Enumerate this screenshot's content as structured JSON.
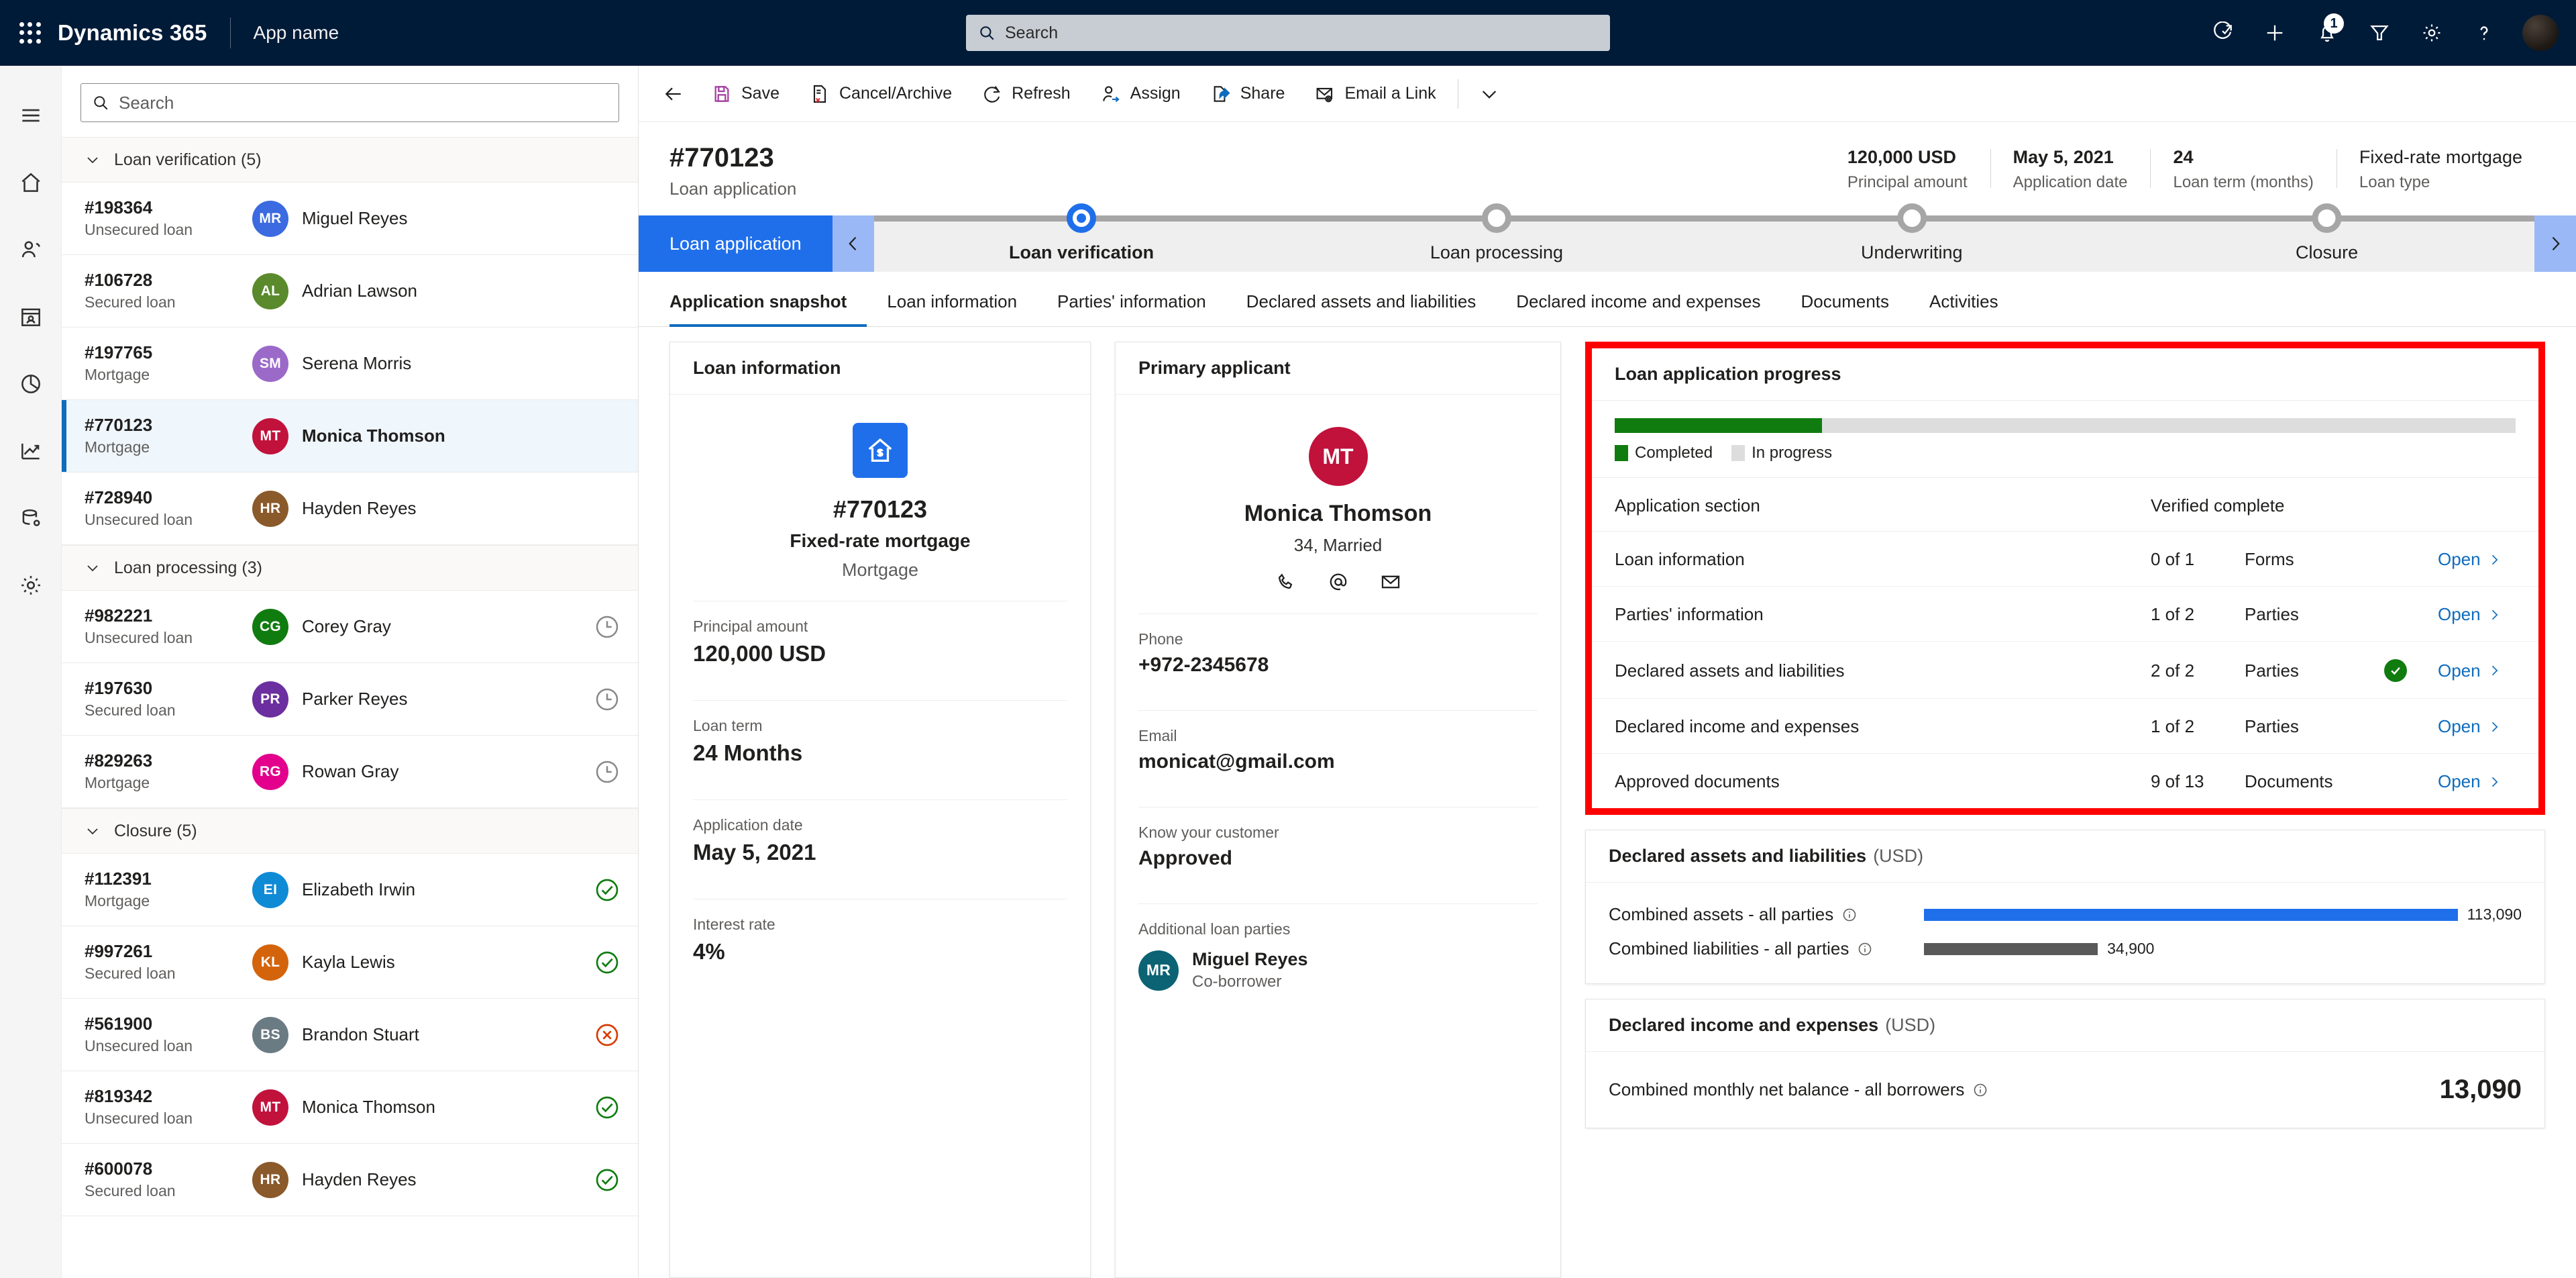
{
  "topnav": {
    "brand": "Dynamics 365",
    "app_name": "App name",
    "search_placeholder": "Search",
    "notification_count": "1",
    "icons": [
      "waffle-icon",
      "check-arrow-icon",
      "plus-icon",
      "bell-icon",
      "filter-icon",
      "gear-icon",
      "help-icon",
      "user-avatar"
    ]
  },
  "rail": {
    "items": [
      {
        "name": "hamburger-menu-icon"
      },
      {
        "name": "home-icon"
      },
      {
        "name": "recent-contacts-icon"
      },
      {
        "name": "pinned-records-icon"
      },
      {
        "name": "dashboard-icon"
      },
      {
        "name": "analytics-icon"
      },
      {
        "name": "data-icon"
      },
      {
        "name": "settings-icon"
      }
    ]
  },
  "list": {
    "search_placeholder": "Search",
    "groups": [
      {
        "label": "Loan verification (5)",
        "rows": [
          {
            "id": "#198364",
            "type": "Unsecured loan",
            "initials": "MR",
            "name": "Miguel Reyes",
            "color": "#3b6ae1",
            "status": "",
            "selected": false
          },
          {
            "id": "#106728",
            "type": "Secured loan",
            "initials": "AL",
            "name": "Adrian Lawson",
            "color": "#5a8a2b",
            "status": "",
            "selected": false
          },
          {
            "id": "#197765",
            "type": "Mortgage",
            "initials": "SM",
            "name": "Serena Morris",
            "color": "#9b6ac9",
            "status": "",
            "selected": false
          },
          {
            "id": "#770123",
            "type": "Mortgage",
            "initials": "MT",
            "name": "Monica Thomson",
            "color": "#c1123c",
            "status": "",
            "selected": true
          },
          {
            "id": "#728940",
            "type": "Unsecured loan",
            "initials": "HR",
            "name": "Hayden Reyes",
            "color": "#8a5a2b",
            "status": "",
            "selected": false
          }
        ]
      },
      {
        "label": "Loan processing (3)",
        "rows": [
          {
            "id": "#982221",
            "type": "Unsecured loan",
            "initials": "CG",
            "name": "Corey Gray",
            "color": "#107c10",
            "status": "pending",
            "selected": false
          },
          {
            "id": "#197630",
            "type": "Secured loan",
            "initials": "PR",
            "name": "Parker Reyes",
            "color": "#6b2fa0",
            "status": "pending",
            "selected": false
          },
          {
            "id": "#829263",
            "type": "Mortgage",
            "initials": "RG",
            "name": "Rowan Gray",
            "color": "#e3008c",
            "status": "pending",
            "selected": false
          }
        ]
      },
      {
        "label": "Closure (5)",
        "rows": [
          {
            "id": "#112391",
            "type": "Mortgage",
            "initials": "EI",
            "name": "Elizabeth Irwin",
            "color": "#0f8bd6",
            "status": "approved",
            "selected": false
          },
          {
            "id": "#997261",
            "type": "Secured loan",
            "initials": "KL",
            "name": "Kayla Lewis",
            "color": "#d4640c",
            "status": "approved",
            "selected": false
          },
          {
            "id": "#561900",
            "type": "Unsecured loan",
            "initials": "BS",
            "name": "Brandon Stuart",
            "color": "#6b7b83",
            "status": "rejected",
            "selected": false
          },
          {
            "id": "#819342",
            "type": "Unsecured loan",
            "initials": "MT",
            "name": "Monica Thomson",
            "color": "#c1123c",
            "status": "approved",
            "selected": false
          },
          {
            "id": "#600078",
            "type": "Secured loan",
            "initials": "HR",
            "name": "Hayden Reyes",
            "color": "#8a5a2b",
            "status": "approved",
            "selected": false
          }
        ]
      }
    ]
  },
  "commandbar": {
    "back": "back-arrow-icon",
    "buttons": [
      {
        "label": "Save",
        "icon": "save-icon"
      },
      {
        "label": "Cancel/Archive",
        "icon": "cancel-archive-icon"
      },
      {
        "label": "Refresh",
        "icon": "refresh-icon"
      },
      {
        "label": "Assign",
        "icon": "assign-icon"
      },
      {
        "label": "Share",
        "icon": "share-icon"
      },
      {
        "label": "Email a Link",
        "icon": "email-link-icon"
      }
    ],
    "overflow": "chevron-down-icon"
  },
  "record": {
    "title": "#770123",
    "subtitle": "Loan application",
    "header_fields": [
      {
        "value": "120,000 USD",
        "label": "Principal amount"
      },
      {
        "value": "May 5, 2021",
        "label": "Application date"
      },
      {
        "value": "24",
        "label": "Loan term (months)"
      },
      {
        "value": "Fixed-rate mortgage",
        "label": "Loan type"
      }
    ]
  },
  "bpf": {
    "active_stage": "Loan application",
    "stages": [
      {
        "label": "Loan verification",
        "state": "current"
      },
      {
        "label": "Loan processing",
        "state": "future"
      },
      {
        "label": "Underwriting",
        "state": "future"
      },
      {
        "label": "Closure",
        "state": "future"
      }
    ]
  },
  "tabs": [
    {
      "label": "Application snapshot",
      "active": true
    },
    {
      "label": "Loan information",
      "active": false
    },
    {
      "label": "Parties' information",
      "active": false
    },
    {
      "label": "Declared assets and liabilities",
      "active": false
    },
    {
      "label": "Declared income and expenses",
      "active": false
    },
    {
      "label": "Documents",
      "active": false
    },
    {
      "label": "Activities",
      "active": false
    }
  ],
  "loan_information": {
    "card_title": "Loan information",
    "icon": "house-dollar-icon",
    "number": "#770123",
    "product": "Fixed-rate mortgage",
    "category": "Mortgage",
    "fields": [
      {
        "label": "Principal amount",
        "value": "120,000 USD"
      },
      {
        "label": "Loan term",
        "value": "24 Months"
      },
      {
        "label": "Application date",
        "value": "May 5, 2021"
      },
      {
        "label": "Interest rate",
        "value": "4%"
      }
    ]
  },
  "primary_applicant": {
    "card_title": "Primary applicant",
    "initials": "MT",
    "avatar_color": "#c1123c",
    "name": "Monica Thomson",
    "meta": "34, Married",
    "action_icons": [
      "phone-icon",
      "at-icon",
      "mail-icon"
    ],
    "fields": [
      {
        "label": "Phone",
        "value": "+972-2345678"
      },
      {
        "label": "Email",
        "value": "monicat@gmail.com"
      },
      {
        "label": "Know your customer",
        "value": "Approved"
      }
    ],
    "additional_parties_label": "Additional loan parties",
    "additional_parties": [
      {
        "initials": "MR",
        "name": "Miguel Reyes",
        "role": "Co-borrower",
        "color": "#0b6374"
      }
    ]
  },
  "progress_card": {
    "title": "Loan application progress",
    "progress_percent": 23,
    "completed_color": "#107c10",
    "inprogress_color": "#dddddd",
    "legend": [
      {
        "label": "Completed",
        "color": "#107c10"
      },
      {
        "label": "In progress",
        "color": "#dddddd"
      }
    ],
    "columns": [
      "Application section",
      "Verified complete"
    ],
    "rows": [
      {
        "section": "Loan information",
        "count": "0 of 1",
        "unit": "Forms",
        "verified": false,
        "open": "Open"
      },
      {
        "section": "Parties' information",
        "count": "1 of 2",
        "unit": "Parties",
        "verified": false,
        "open": "Open"
      },
      {
        "section": "Declared assets and liabilities",
        "count": "2 of 2",
        "unit": "Parties",
        "verified": true,
        "open": "Open"
      },
      {
        "section": "Declared income and expenses",
        "count": "1 of 2",
        "unit": "Parties",
        "verified": false,
        "open": "Open"
      },
      {
        "section": "Approved documents",
        "count": "9 of 13",
        "unit": "Documents",
        "verified": false,
        "open": "Open"
      }
    ]
  },
  "assets_card": {
    "title": "Declared assets and liabilities",
    "title_unit": "(USD)"
  },
  "income_card": {
    "title": "Declared income and expenses",
    "title_unit": "(USD)",
    "row_label": "Combined monthly net balance - all borrowers",
    "row_value": "13,090"
  },
  "chart_data": [
    {
      "type": "bar",
      "title": "Declared assets and liabilities (USD)",
      "orientation": "horizontal",
      "categories": [
        "Combined assets - all parties",
        "Combined liabilities - all parties"
      ],
      "values": [
        113090,
        34900
      ],
      "value_labels": [
        "113,090",
        "34,900"
      ],
      "colors": [
        "#1f6feb",
        "#595959"
      ],
      "xlabel": "",
      "ylabel": "",
      "xlim": [
        0,
        120000
      ],
      "grid": false,
      "legend": "none"
    },
    {
      "type": "bar",
      "title": "Loan application progress",
      "orientation": "horizontal-stacked",
      "categories": [
        "Progress"
      ],
      "series": [
        {
          "name": "Completed",
          "values": [
            23
          ],
          "color": "#107c10"
        },
        {
          "name": "In progress",
          "values": [
            77
          ],
          "color": "#dddddd"
        }
      ],
      "xlabel": "",
      "ylabel": "",
      "xlim": [
        0,
        100
      ],
      "grid": false,
      "legend": "bottom-left"
    }
  ]
}
